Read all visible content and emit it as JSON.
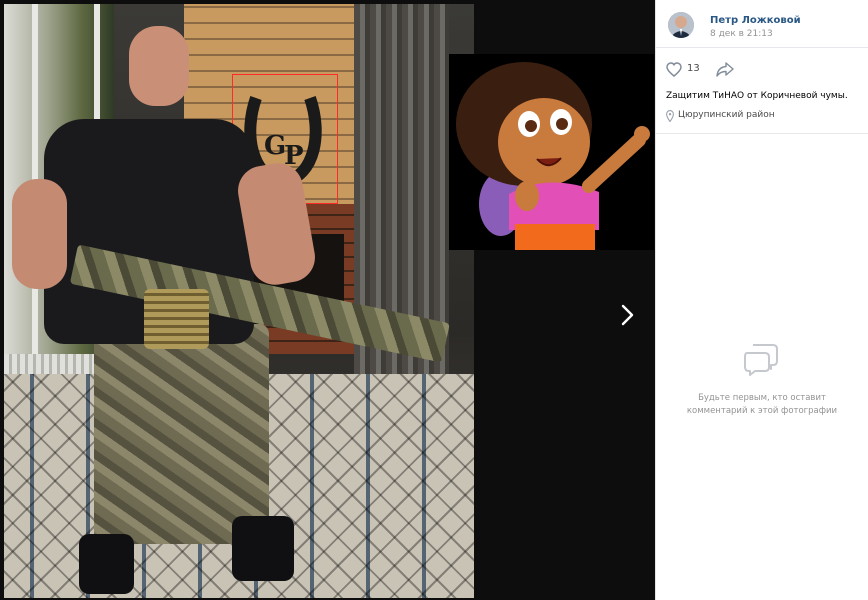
{
  "post": {
    "author_name": "Петр Ложковой",
    "date": "8 дек в 21:13",
    "likes_count": "13",
    "caption": "Zащитим ТиНАО от Коричневой чумы.",
    "location": "Цюрупинский район"
  },
  "comments": {
    "empty_line1": "Будьте первым, кто оставит",
    "empty_line2": "комментарий к этой фотографии"
  },
  "icons": {
    "like": "heart-icon",
    "share": "share-arrow-icon",
    "location": "map-pin-icon",
    "comments": "speech-bubbles-icon",
    "next": "chevron-right-icon"
  },
  "colors": {
    "viewer_background": "#0d0d0d",
    "author_link": "#2a5885",
    "muted_text": "#939393",
    "highlight_frame": "#ff2a2a"
  }
}
